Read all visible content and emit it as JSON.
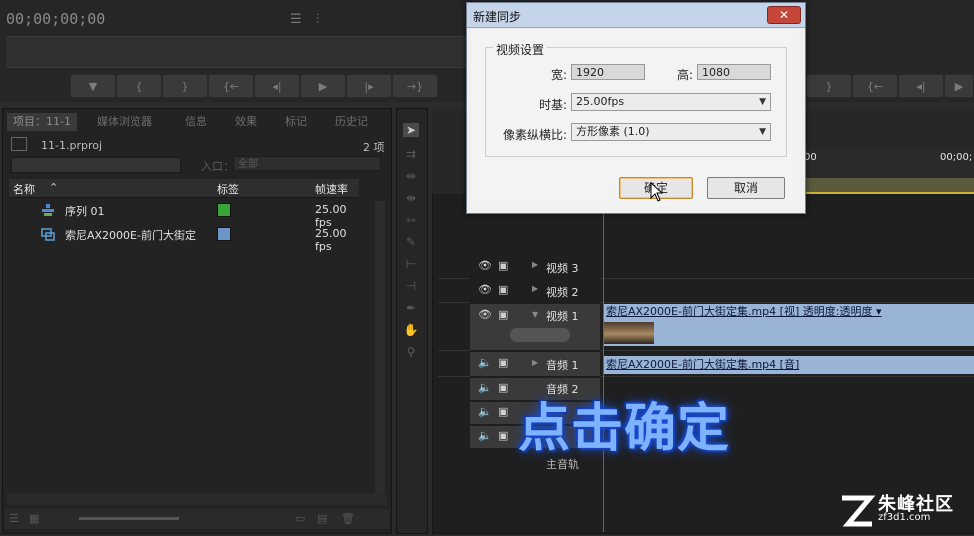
{
  "monitor": {
    "timecode": "00;00;00;00"
  },
  "project_panel": {
    "tabs": [
      "项目：11-1",
      "媒体浏览器",
      "信息",
      "效果",
      "标记",
      "历史记"
    ],
    "project_file": "11-1.prproj",
    "item_count": "2 项",
    "in_label": "入口：",
    "in_value": "全部",
    "columns": {
      "name": "名称",
      "label": "标签",
      "frame_rate": "帧速率"
    },
    "items": [
      {
        "name": "序列 01",
        "label_color": "#3aa33a",
        "frame_rate": "25.00 fps"
      },
      {
        "name": "索尼AX2000E-前门大街定",
        "label_color": "#6e96c8",
        "frame_rate": "25.00 fps"
      }
    ]
  },
  "timeline": {
    "ruler_labels": [
      "00",
      "00;00;"
    ],
    "tracks": {
      "video3": "视频 3",
      "video2": "视频 2",
      "video1": "视频 1",
      "audio1": "音频 1",
      "audio2": "音频 2",
      "master": "主音轨"
    },
    "video_clip": "索尼AX2000E-前门大街定集.mp4 [视]  透明度:透明度 ▾",
    "audio_clip": "索尼AX2000E-前门大街定集.mp4 [音]"
  },
  "dialog": {
    "title": "新建同步",
    "group_label": "视频设置",
    "width_label": "宽:",
    "width_value": "1920",
    "height_label": "高:",
    "height_value": "1080",
    "timebase_label": "时基:",
    "timebase_value": "25.00fps",
    "par_label": "像素纵横比:",
    "par_value": "方形像素 (1.0)",
    "ok": "确定",
    "cancel": "取消",
    "close": "✕"
  },
  "caption": "点击确定",
  "watermark": {
    "name": "朱峰社区",
    "url": "zf3d1.com"
  }
}
